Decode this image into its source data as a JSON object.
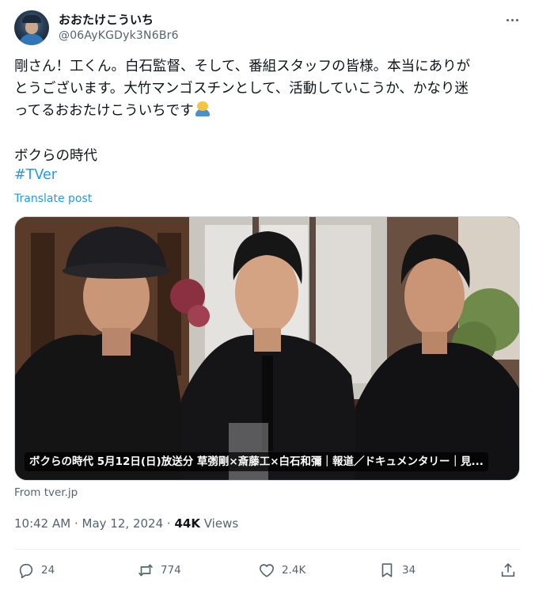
{
  "author": {
    "display_name": "おおたけこういち",
    "handle": "@06AyKGDyk3N6Br6"
  },
  "tweet": {
    "lines": [
      "剛さん！工くん。白石監督、そして、番組スタッフの皆様。本当にありが",
      "とうございます。大竹マンゴスチンとして、活動していこうか、かなり迷",
      "ってるおおたけこういちです"
    ],
    "subtitle": "ボクらの時代",
    "hashtag": "#TVer",
    "translate_label": "Translate post"
  },
  "media": {
    "caption": "ボクらの時代 5月12日(日)放送分 草彅剛×斎藤工×白石和彌｜報道／ドキュメンタリー｜見..."
  },
  "source": "From tver.jp",
  "meta": {
    "time": "10:42 AM",
    "separator1": "·",
    "date": "May 12, 2024",
    "separator2": "·",
    "views_count": "44K",
    "views_label": "Views"
  },
  "actions": {
    "replies": "24",
    "reposts": "774",
    "likes": "2.4K",
    "bookmarks": "34"
  },
  "icons": {
    "more": "more-dots-icon",
    "reply": "reply-bubble-icon",
    "repost": "repost-arrows-icon",
    "like": "heart-icon",
    "bookmark": "bookmark-icon",
    "share": "share-upload-icon"
  },
  "colors": {
    "text": "#0f1419",
    "secondary": "#536471",
    "link": "#1d9bf0",
    "border": "#cfd9de"
  }
}
